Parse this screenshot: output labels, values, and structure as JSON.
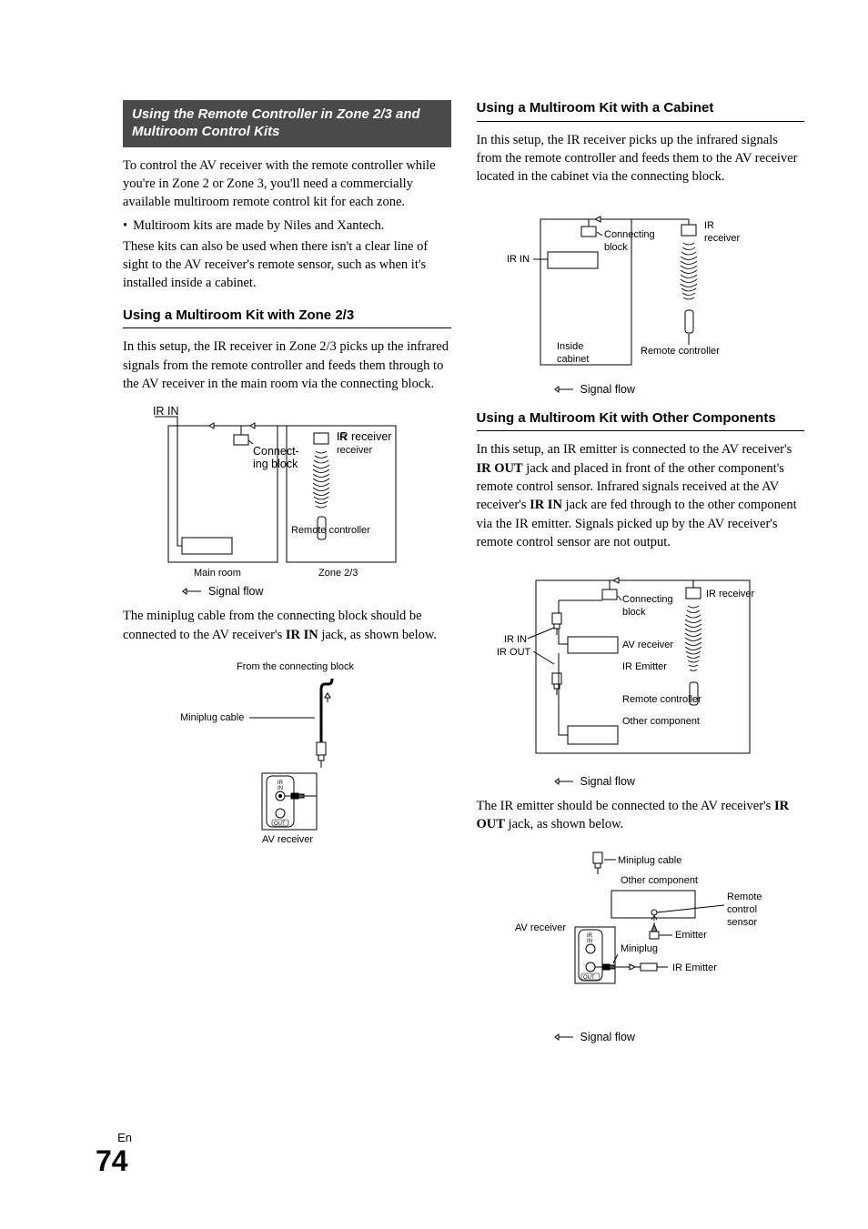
{
  "left": {
    "sectionTitle": "Using the Remote Controller in Zone 2/3 and Multiroom Control Kits",
    "p1": "To control the AV receiver with the remote controller while you're in Zone 2 or Zone 3, you'll need a commercially available multiroom remote control kit for each zone.",
    "bullet1": "Multiroom kits are made by Niles and Xantech.",
    "p2": "These kits can also be used when there isn't a clear line of sight to the AV receiver's remote sensor, such as when it's installed inside a cabinet.",
    "h1": "Using a Multiroom Kit with Zone 2/3",
    "p3": "In this setup, the IR receiver in Zone 2/3 picks up the infrared signals from the remote controller and feeds them through to the AV receiver in the main room via the connecting block.",
    "diag1": {
      "irIn": "IR IN",
      "connectingBlock1": "Connect-",
      "connectingBlock2": "ing block",
      "irReceiver": "IR receiver",
      "remote": "Remote controller",
      "mainRoom": "Main room",
      "zone": "Zone 2/3",
      "signalFlow": "Signal flow"
    },
    "p4a": "The miniplug cable from the connecting block should be connected to the AV receiver's ",
    "p4b": "IR IN",
    "p4c": " jack, as shown below.",
    "diag2": {
      "fromBlock": "From the connecting block",
      "miniplug": "Miniplug cable",
      "irIn": "IR",
      "irIn2": "IN",
      "out": "OUT",
      "avReceiver": "AV receiver"
    }
  },
  "right": {
    "h1": "Using a Multiroom Kit with a Cabinet",
    "p1": "In this setup, the IR receiver picks up the infrared signals from the remote controller and feeds them to the AV receiver located in the cabinet via the connecting block.",
    "diag1": {
      "irIn": "IR IN",
      "connecting1": "Connecting",
      "connecting2": "block",
      "irReceiver1": "IR",
      "irReceiver2": "receiver",
      "inside1": "Inside",
      "inside2": "cabinet",
      "remote": "Remote controller",
      "signalFlow": "Signal flow"
    },
    "h2": "Using a Multiroom Kit with Other Components",
    "p2a": "In this setup, an IR emitter is connected to the AV receiver's ",
    "p2b": "IR OUT",
    "p2c": " jack and placed in front of the other component's remote control sensor. Infrared signals received at the AV receiver's ",
    "p2d": "IR IN",
    "p2e": " jack are fed through to the other component via the IR emitter. Signals picked up by the AV receiver's remote control sensor are not output.",
    "diag2": {
      "irIn": "IR IN",
      "irOut": "IR OUT",
      "connecting1": "Connecting",
      "connecting2": "block",
      "avReceiver": "AV receiver",
      "irReceiver": "IR receiver",
      "irEmitter": "IR Emitter",
      "remote": "Remote controller",
      "other": "Other component",
      "signalFlow": "Signal flow"
    },
    "p3a": "The IR emitter should be connected to the AV receiver's ",
    "p3b": "IR OUT",
    "p3c": " jack, as shown below.",
    "diag3": {
      "miniplugCable": "Miniplug cable",
      "otherComponent": "Other component",
      "avReceiver": "AV receiver",
      "remote1": "Remote",
      "remote2": "control",
      "remote3": "sensor",
      "emitter": "Emitter",
      "miniplug": "Miniplug",
      "irEmitter": "IR Emitter",
      "irIn": "IR",
      "irIn2": "IN",
      "out": "OUT",
      "signalFlow": "Signal flow"
    }
  },
  "footer": {
    "lang": "En",
    "page": "74"
  }
}
